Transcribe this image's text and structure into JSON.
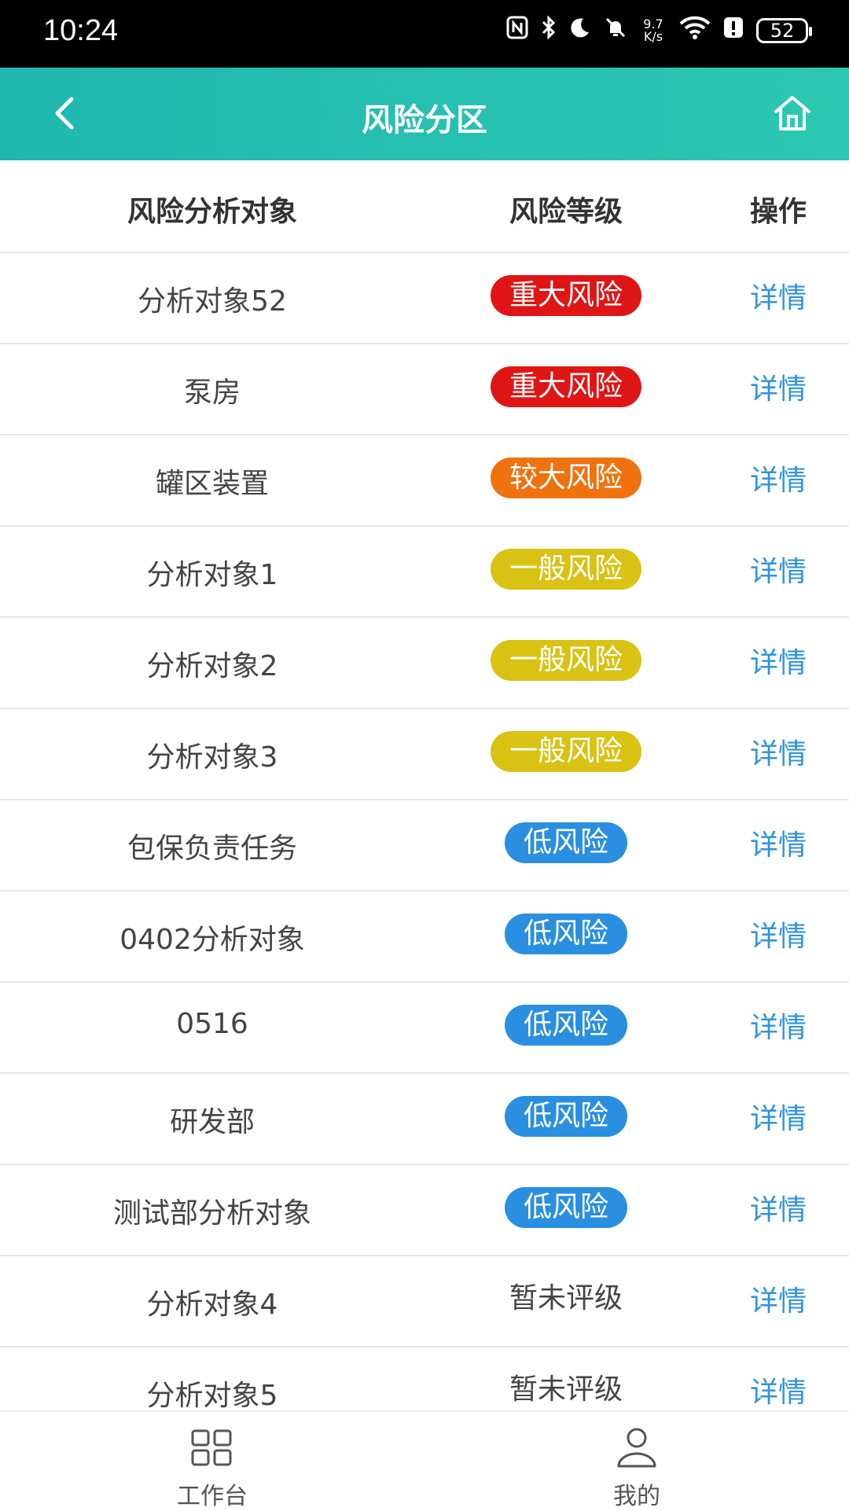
{
  "status_bar": {
    "time": "10:24",
    "net_speed_top": "9.7",
    "net_speed_bottom": "K/s",
    "battery": "52"
  },
  "header": {
    "title": "风险分区",
    "back_icon": "chevron-left-icon",
    "home_icon": "home-icon",
    "gradient_start": "#20b7b0",
    "gradient_end": "#2cc8b1"
  },
  "table": {
    "columns": [
      "风险分析对象",
      "风险等级",
      "操作"
    ],
    "rows": [
      {
        "object": "分析对象52",
        "level": "重大风险",
        "level_color": "#e01515",
        "action": "详情"
      },
      {
        "object": "泵房",
        "level": "重大风险",
        "level_color": "#e01515",
        "action": "详情"
      },
      {
        "object": "罐区装置",
        "level": "较大风险",
        "level_color": "#f0720f",
        "action": "详情"
      },
      {
        "object": "分析对象1",
        "level": "一般风险",
        "level_color": "#d9c214",
        "action": "详情"
      },
      {
        "object": "分析对象2",
        "level": "一般风险",
        "level_color": "#d9c214",
        "action": "详情"
      },
      {
        "object": "分析对象3",
        "level": "一般风险",
        "level_color": "#d9c214",
        "action": "详情"
      },
      {
        "object": "包保负责任务",
        "level": "低风险",
        "level_color": "#2a8fe0",
        "action": "详情"
      },
      {
        "object": "0402分析对象",
        "level": "低风险",
        "level_color": "#2a8fe0",
        "action": "详情"
      },
      {
        "object": "0516",
        "level": "低风险",
        "level_color": "#2a8fe0",
        "action": "详情"
      },
      {
        "object": "研发部",
        "level": "低风险",
        "level_color": "#2a8fe0",
        "action": "详情"
      },
      {
        "object": "测试部分析对象",
        "level": "低风险",
        "level_color": "#2a8fe0",
        "action": "详情"
      },
      {
        "object": "分析对象4",
        "level": "暂未评级",
        "level_color": "",
        "action": "详情"
      },
      {
        "object": "分析对象5",
        "level": "暂未评级",
        "level_color": "",
        "action": "详情"
      }
    ]
  },
  "bottom_nav": {
    "items": [
      {
        "label": "工作台",
        "icon": "grid-icon"
      },
      {
        "label": "我的",
        "icon": "user-icon"
      }
    ]
  }
}
